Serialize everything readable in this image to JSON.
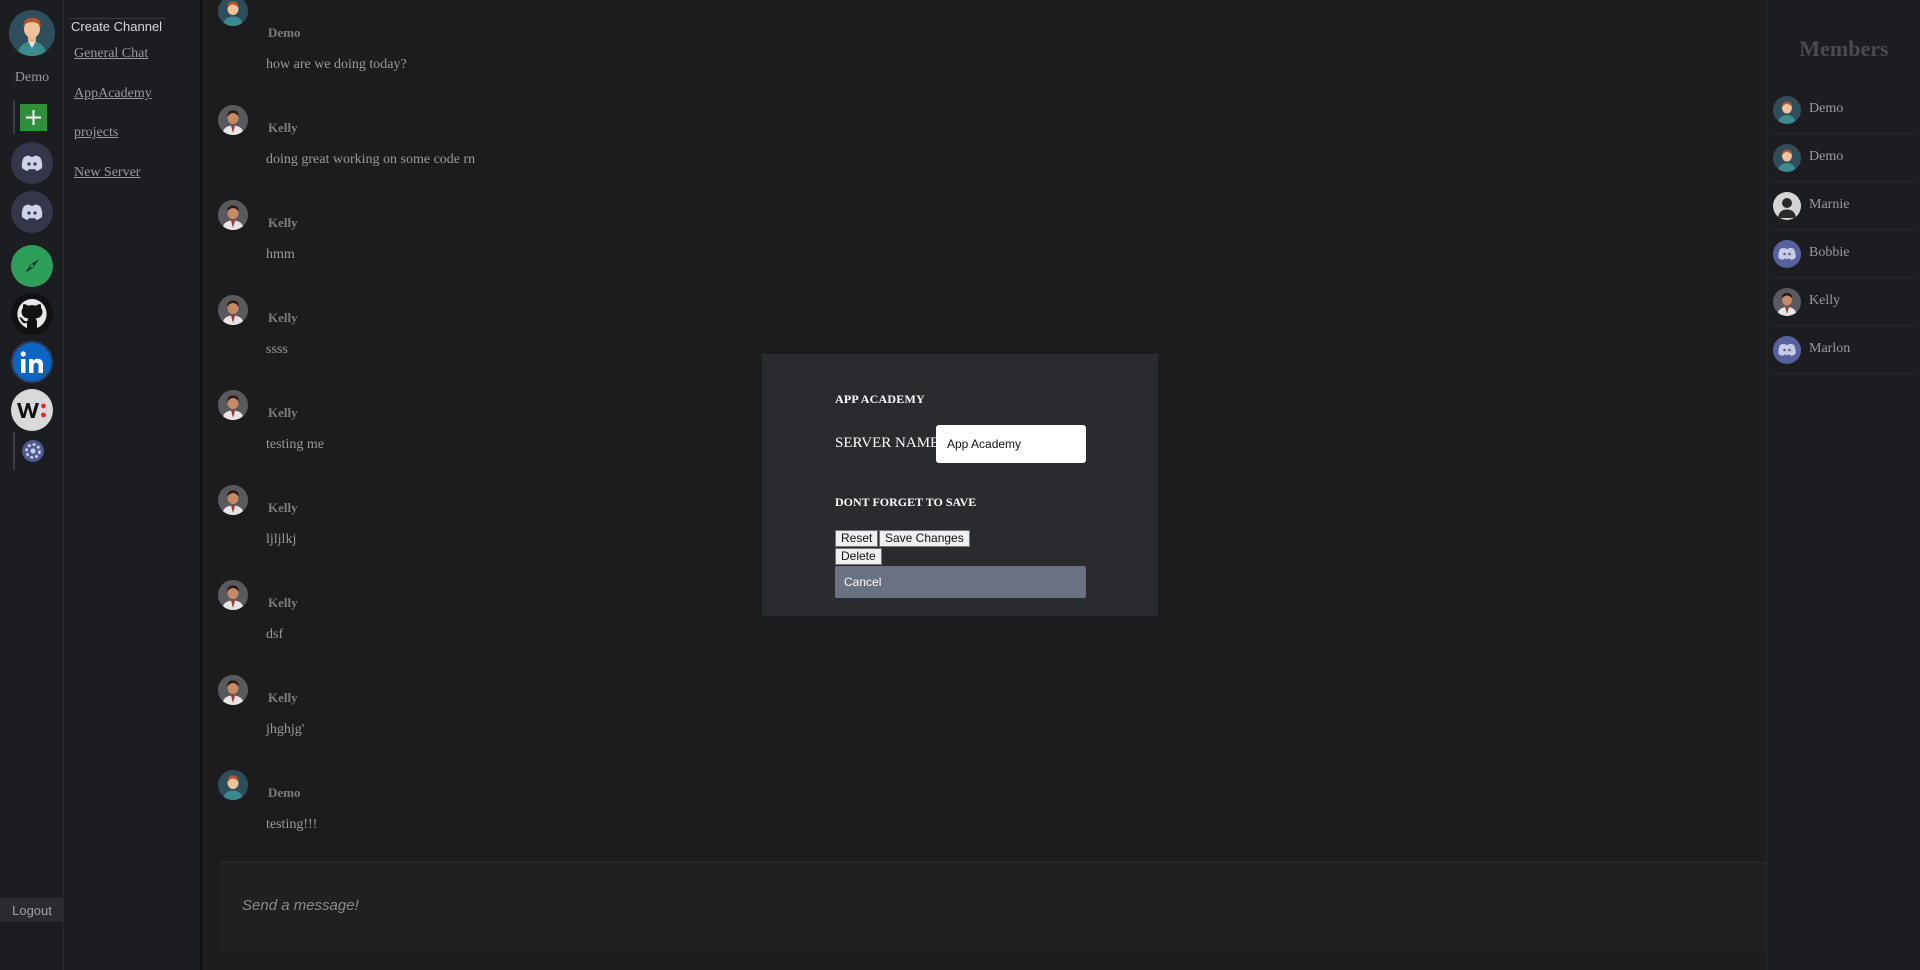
{
  "rail": {
    "user_name": "Demo",
    "logout_label": "Logout"
  },
  "channels": {
    "create_label": "Create Channel",
    "items": [
      "General Chat",
      "AppAcademy",
      "projects",
      "New Server"
    ]
  },
  "messages": [
    {
      "author": "Demo",
      "text": "how are we doing today?"
    },
    {
      "author": "Kelly",
      "text": "doing great working on some code rn"
    },
    {
      "author": "Kelly",
      "text": "hmm"
    },
    {
      "author": "Kelly",
      "text": "ssss"
    },
    {
      "author": "Kelly",
      "text": "testing me"
    },
    {
      "author": "Kelly",
      "text": "ljljlkj"
    },
    {
      "author": "Kelly",
      "text": "dsf"
    },
    {
      "author": "Kelly",
      "text": "jhghjg'"
    },
    {
      "author": "Demo",
      "text": "testing!!!"
    }
  ],
  "composer": {
    "placeholder": "Send a message!"
  },
  "members": {
    "title": "Members",
    "items": [
      "Demo",
      "Demo",
      "Marnie",
      "Bobbie",
      "Kelly",
      "Marlon"
    ]
  },
  "modal": {
    "title": "APP ACADEMY",
    "server_name_label": "SERVER NAME",
    "server_name_value": "App Academy",
    "warning": "DONT FORGET TO SAVE",
    "reset_label": "Reset",
    "save_label": "Save Changes",
    "delete_label": "Delete",
    "cancel_label": "Cancel"
  },
  "colors": {
    "background": "#1c1c1e",
    "modal": "#2a2b2e",
    "cancel_button": "#6a7180",
    "add_server": "#2f8f3a",
    "linkedin": "#0a66c2"
  }
}
